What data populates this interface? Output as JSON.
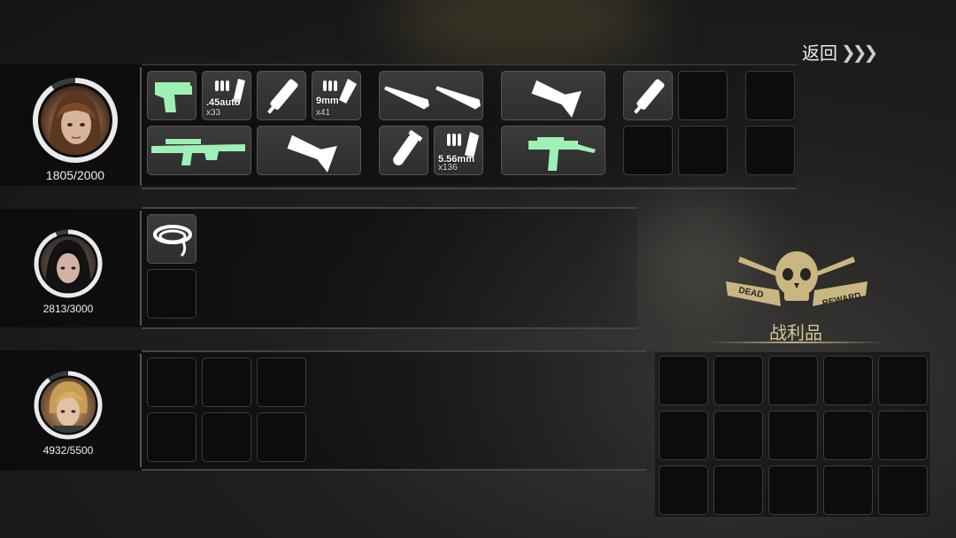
{
  "header": {
    "back_label": "返回",
    "back_arrows": "❯❯❯"
  },
  "characters": [
    {
      "hp": "1805/2000",
      "hp_value": 1805,
      "hp_max": 2000
    },
    {
      "hp": "2813/3000",
      "hp_value": 2813,
      "hp_max": 3000
    },
    {
      "hp": "4932/5500",
      "hp_value": 4932,
      "hp_max": 5500
    }
  ],
  "inventory1": {
    "ammo_45": {
      "caliber": ".45auto",
      "count": "x33"
    },
    "ammo_9mm": {
      "caliber": "9mm",
      "count": "x41"
    },
    "ammo_556": {
      "caliber": "5.56mm",
      "count": "x136"
    }
  },
  "loot": {
    "title": "战利品",
    "emblem_text": [
      "DEAD",
      "REWARD"
    ]
  },
  "colors": {
    "weapon_green": "#9ef0b4",
    "gold": "#c9b680",
    "ring": "#e8e8e8"
  }
}
